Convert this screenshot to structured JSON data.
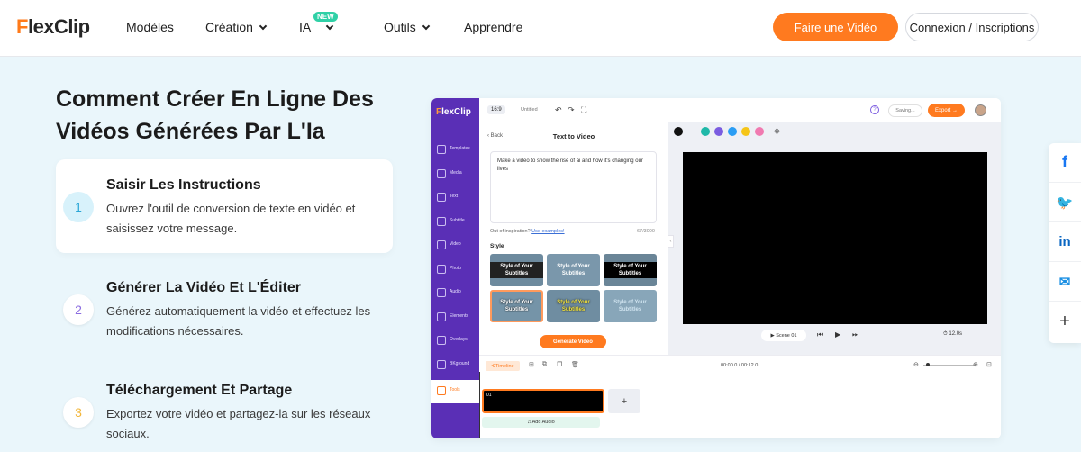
{
  "brand": {
    "logo_first": "F",
    "logo_rest": "lexClip"
  },
  "nav": {
    "items": [
      "Modèles",
      "Création",
      "IA",
      "Outils",
      "Apprendre"
    ],
    "new_badge": "NEW",
    "cta_primary": "Faire une Vidéo",
    "cta_secondary": "Connexion / Inscriptions"
  },
  "section": {
    "heading": "Comment Créer En Ligne Des Vidéos Générées Par L'Ia",
    "steps": [
      {
        "num": "1",
        "title": "Saisir Les Instructions",
        "desc": "Ouvrez l'outil de conversion de texte en vidéo et saisissez votre message."
      },
      {
        "num": "2",
        "title": "Générer La Vidéo Et L'Éditer",
        "desc": "Générez automatiquement la vidéo et effectuez les modifications nécessaires."
      },
      {
        "num": "3",
        "title": "Téléchargement Et Partage",
        "desc": "Exportez votre vidéo et partagez-la sur les réseaux sociaux."
      }
    ]
  },
  "editor": {
    "logo_first": "F",
    "logo_rest": "lexClip",
    "ratio": "16:9",
    "doc_title": "Untitled",
    "saving": "Saving...",
    "export": "Export →",
    "sidebar": [
      "Templates",
      "Media",
      "Text",
      "Subtitle",
      "Video",
      "Photo",
      "Audio",
      "Elements",
      "Overlays",
      "BKground",
      "Tools"
    ],
    "panel": {
      "back": "‹ Back",
      "title": "Text to Video",
      "prompt": "Make a video to show the rise of ai and how it's changing our lives",
      "inspiration": "Out of inspiration?",
      "examples_link": "Use examples!",
      "count": "67/3000",
      "style_label": "Style",
      "style_tiles": [
        "Style of Your Subtitles",
        "Style of Your Subtitles",
        "Style of Your Subtitles",
        "Style of Your Subtitles",
        "Style of Your Subtitles",
        "Style of Your Subtitles"
      ],
      "generate": "Generate Video"
    },
    "stage": {
      "swatches": [
        "#111111",
        "#1fb8a8",
        "#7b5ce0",
        "#2a9df4",
        "#f5c518",
        "#f07ab0"
      ],
      "scene": "▶ Scene 01",
      "duration": "12.0s"
    },
    "timeline": {
      "tab": "Timeline",
      "time": "00:00.0 / 00:12.0",
      "clip_label": "01",
      "add_audio": "♫ Add Audio"
    }
  },
  "share": {
    "colors": {
      "facebook": "#1877f2",
      "twitter": "#1da1f2",
      "linkedin": "#0a66c2",
      "email": "#1a8fe3"
    }
  }
}
